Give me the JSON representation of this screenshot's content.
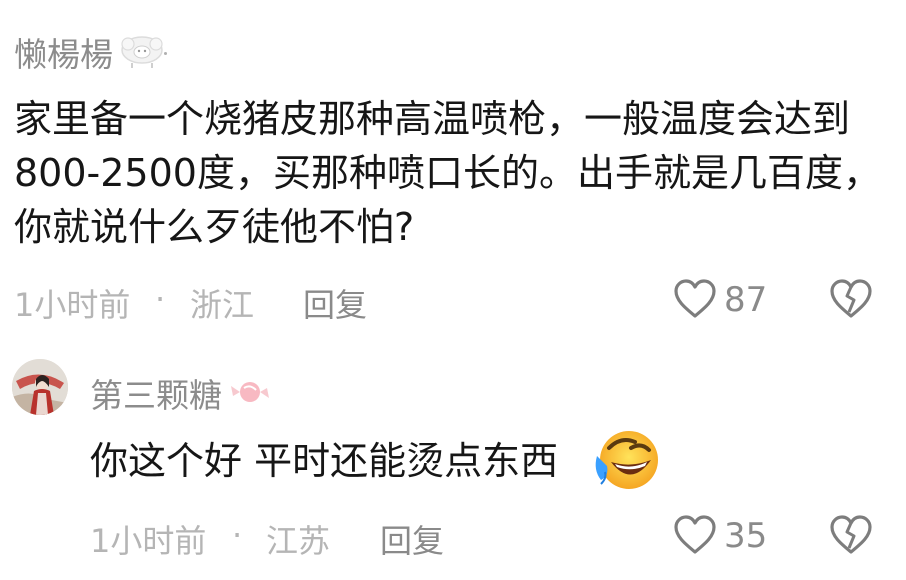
{
  "comments": [
    {
      "username": "懒楊楊",
      "text": "家里备一个烧猪皮那种高温喷枪，一般温度会达到800-2500度，买那种喷口长的。出手就是几百度，你就说什么歹徒他不怕?",
      "time": "1小时前",
      "dot": "·",
      "location": "浙江",
      "reply_label": "回复",
      "likes": "87",
      "icons": {
        "badge": "sheep-emoji-icon",
        "like": "heart-outline-icon",
        "dislike": "broken-heart-icon"
      }
    },
    {
      "username": "第三颗糖",
      "text": "你这个好 平时还能烫点东西",
      "time": "1小时前",
      "dot": "·",
      "location": "江苏",
      "reply_label": "回复",
      "likes": "35",
      "icons": {
        "badge": "candy-emoji-icon",
        "emoji": "rofl-emoji-icon",
        "like": "heart-outline-icon",
        "dislike": "broken-heart-icon"
      }
    }
  ],
  "colors": {
    "username": "#8c8c8c",
    "text": "#161616",
    "meta": "#b5b5b5",
    "action": "#8a8a8a"
  }
}
